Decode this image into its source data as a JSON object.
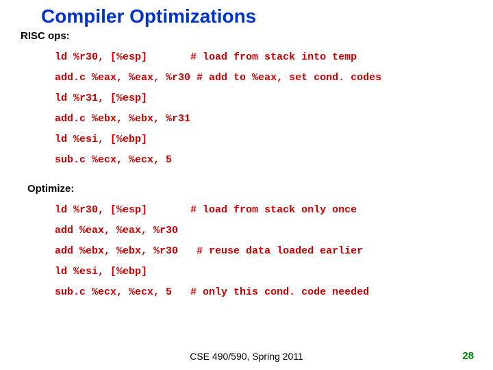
{
  "title": "Compiler Optimizations",
  "section1_label": "RISC ops:",
  "risc": {
    "l1_code": "ld %r30, [%esp]       ",
    "l1_comment": "# load from stack into temp",
    "l2_code": "add.c %eax, %eax, %r30 ",
    "l2_comment": "# add to %eax, set cond. codes",
    "l3": "ld %r31, [%esp]",
    "l4": "add.c %ebx, %ebx, %r31",
    "l5": "ld %esi, [%ebp]",
    "l6": "sub.c %ecx, %ecx, 5"
  },
  "section2_label": "Optimize:",
  "opt": {
    "l1_code": "ld %r30, [%esp]       ",
    "l1_comment": "# load from stack only once",
    "l2": "add %eax, %eax, %r30",
    "l3_code": "add %ebx, %ebx, %r30   ",
    "l3_comment": "# reuse data loaded earlier",
    "l4": "ld %esi, [%ebp]",
    "l5_code": "sub.c %ecx, %ecx, 5   ",
    "l5_comment": "# only this cond. code needed"
  },
  "footer": "CSE 490/590, Spring 2011",
  "page_num": "28"
}
